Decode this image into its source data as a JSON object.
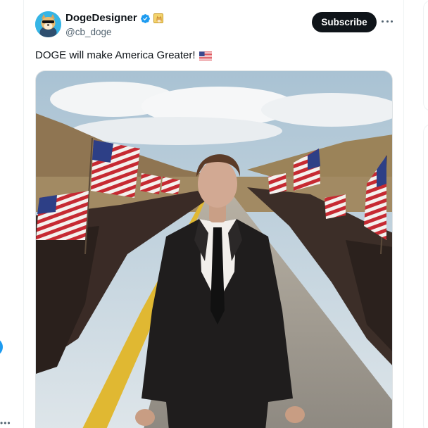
{
  "post": {
    "author": {
      "display_name": "DogeDesigner",
      "handle": "@cb_doge",
      "verified": true,
      "avatar_icon": "doge-avatar-icon",
      "affiliate_badge_icon": "affiliate-badge-icon"
    },
    "subscribe_label": "Subscribe",
    "more_icon": "more-options-icon",
    "text": "DOGE will make America Greater!",
    "text_emoji": "us-flag-emoji",
    "media": {
      "type": "photo",
      "alt_icon": "photo-man-in-suit-walking-road-with-american-flags-crowd"
    }
  },
  "colors": {
    "accent": "#1d9bf0",
    "text_primary": "#0f1419",
    "text_secondary": "#536471",
    "subscribe_bg": "#0f1419"
  }
}
